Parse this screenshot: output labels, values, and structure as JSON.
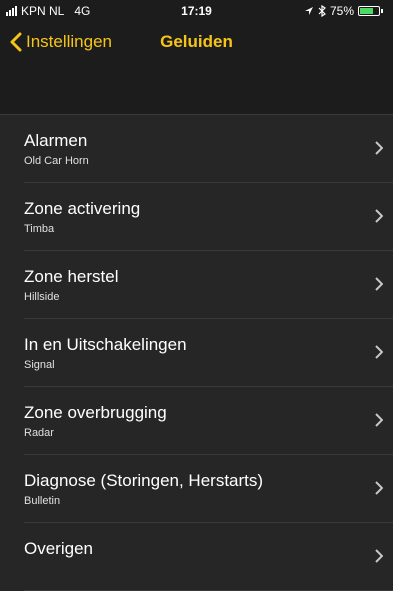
{
  "status_bar": {
    "carrier": "KPN NL",
    "network": "4G",
    "time": "17:19",
    "battery": "75%",
    "battery_level": 0.75
  },
  "nav": {
    "back_label": "Instellingen",
    "title": "Geluiden"
  },
  "items": [
    {
      "title": "Alarmen",
      "subtitle": "Old Car Horn"
    },
    {
      "title": "Zone activering",
      "subtitle": "Timba"
    },
    {
      "title": "Zone herstel",
      "subtitle": "Hillside"
    },
    {
      "title": "In en Uitschakelingen",
      "subtitle": "Signal"
    },
    {
      "title": "Zone overbrugging",
      "subtitle": "Radar"
    },
    {
      "title": "Diagnose (Storingen, Herstarts)",
      "subtitle": "Bulletin"
    },
    {
      "title": "Overigen",
      "subtitle": ""
    }
  ],
  "colors": {
    "accent": "#f5c518",
    "background": "#1c1c1c",
    "cell": "#262626",
    "battery": "#4cd964"
  }
}
